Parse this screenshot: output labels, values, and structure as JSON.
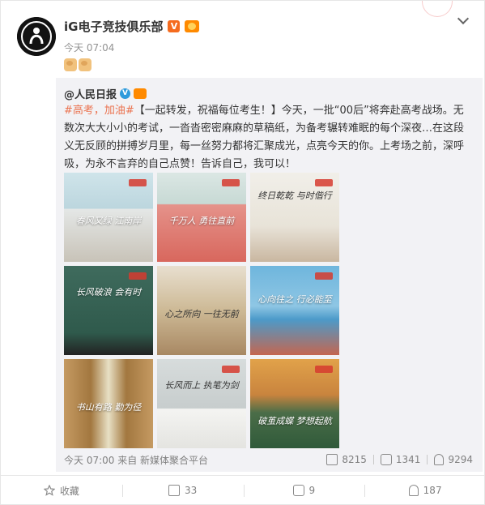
{
  "post": {
    "author": "iG电子竞技俱乐部",
    "verified_badge": "V",
    "time": "今天 07:04"
  },
  "repost": {
    "original_author": "@人民日报",
    "verified_badge": "V",
    "hashtag": "#高考，加油#",
    "text": "【一起转发，祝福每位考生！】今天，一批“00后”将奔赴高考战场。无数次大大小小的考试，一沓沓密密麻麻的草稿纸，为备考辗转难眠的每个深夜…在这段义无反顾的拼搏岁月里，每一丝努力都将汇聚成光，点亮今天的你。上考场之前，深呼吸，为永不言弃的自己点赞！告诉自己，我可以！",
    "images": [
      {
        "caption": "春风又绿 江南岸"
      },
      {
        "caption": "千万人 勇往直前"
      },
      {
        "caption": "终日乾乾 与时偕行"
      },
      {
        "caption": "长风破浪 会有时"
      },
      {
        "caption": "心之所向 一往无前"
      },
      {
        "caption": "心向往之 行必能至"
      },
      {
        "caption": "书山有路 勤为径"
      },
      {
        "caption": "长风而上 执笔为剑"
      },
      {
        "caption": "破茧成蝶 梦想起航"
      }
    ],
    "meta": {
      "time_source": "今天 07:00 来自 新媒体聚合平台",
      "forwards": "8215",
      "comments": "1341",
      "likes": "9294"
    }
  },
  "actions": {
    "favorite": "收藏",
    "forward_count": "33",
    "comment_count": "9",
    "like_count": "187"
  },
  "icons": [
    "more-icon",
    "forward-icon",
    "comment-icon",
    "like-icon",
    "star-icon"
  ],
  "colors": {
    "hashtag": "#eb7350",
    "repost_bg": "#f2f2f5",
    "muted": "#808080"
  }
}
